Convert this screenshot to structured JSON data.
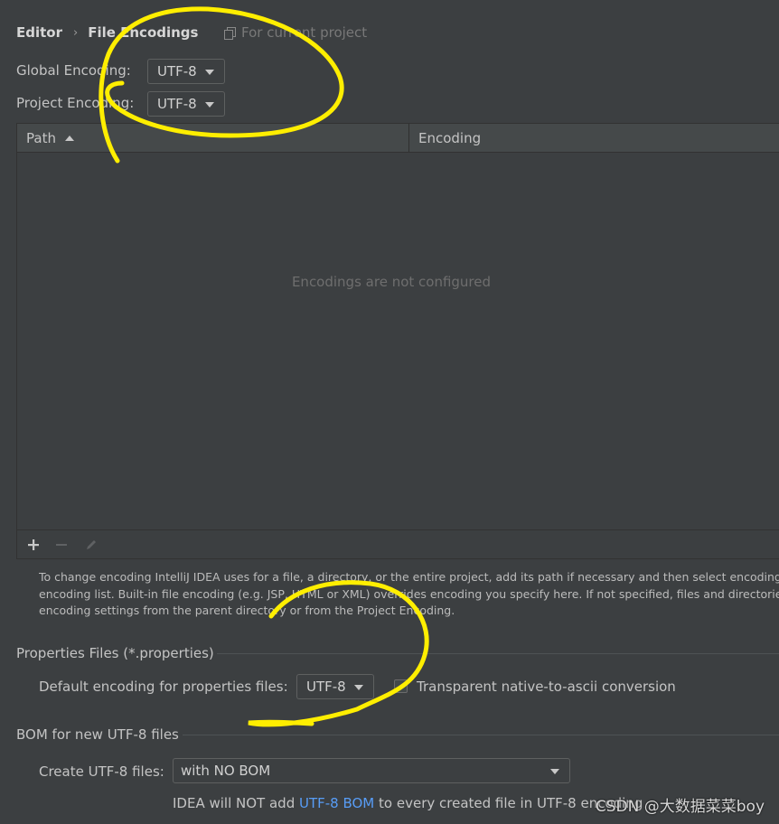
{
  "breadcrumb": {
    "section": "Editor",
    "separator": "›",
    "page": "File Encodings"
  },
  "scope": {
    "text": "For current project",
    "icon": "copy-icon"
  },
  "global_encoding": {
    "label": "Global Encoding:",
    "value": "UTF-8"
  },
  "project_encoding": {
    "label": "Project Encoding:",
    "value": "UTF-8"
  },
  "table": {
    "columns": [
      "Path",
      "Encoding"
    ],
    "sorted_column": "Path",
    "sort_direction": "ascending",
    "empty_text": "Encodings are not configured",
    "toolbar": {
      "add_icon": "plus-icon",
      "remove_icon": "minus-icon",
      "edit_icon": "pencil-icon"
    }
  },
  "help_text": [
    "To change encoding IntelliJ IDEA uses for a file, a directory, or the entire project, add its path if necessary and then select encoding fr",
    "encoding list. Built-in file encoding (e.g. JSP, HTML or XML) overrides encoding you specify here. If not specified, files and directories i",
    "encoding settings from the parent directory or from the Project Encoding."
  ],
  "properties_section": {
    "title": "Properties Files (*.properties)",
    "default_label": "Default encoding for properties files:",
    "default_value": "UTF-8",
    "transparent_label": "Transparent native-to-ascii conversion",
    "transparent_checked": false
  },
  "bom_section": {
    "title": "BOM for new UTF-8 files",
    "create_label": "Create UTF-8 files:",
    "create_value": "with NO BOM",
    "note_prefix": "IDEA will NOT add ",
    "note_link": "UTF-8 BOM",
    "note_suffix": " to every created file in UTF-8 encoding"
  },
  "watermark": "CSDN @大数据菜菜boy",
  "colors": {
    "background": "#3c3f41",
    "annotation": "#ffee00",
    "link": "#589df6"
  }
}
